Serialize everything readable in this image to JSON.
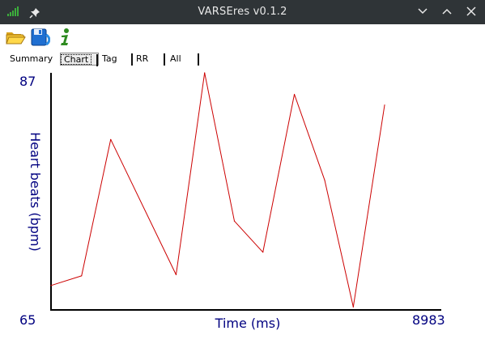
{
  "window": {
    "title": "VARSEres v0.1.2"
  },
  "titlebar": {
    "left_icons": [
      "signal-icon",
      "pin-icon"
    ],
    "right_icons": [
      "minimize-chevron-icon",
      "maximize-chevron-icon",
      "close-icon"
    ]
  },
  "toolbar": {
    "items": [
      {
        "name": "open-folder-button",
        "icon": "folder-open-icon"
      },
      {
        "name": "save-disk-button",
        "icon": "disk-icon"
      },
      {
        "name": "info-button",
        "icon": "info-icon"
      }
    ]
  },
  "tabs": [
    {
      "label": "Summary",
      "active": false
    },
    {
      "label": "Chart",
      "active": true
    },
    {
      "label": "Tag",
      "active": false
    },
    {
      "label": "RR",
      "active": false
    },
    {
      "label": "All",
      "active": false
    }
  ],
  "chart_data": {
    "type": "line",
    "title": "",
    "xlabel": "Time (ms)",
    "ylabel": "Heart beats (bpm)",
    "xlim": [
      0,
      8983
    ],
    "ylim": [
      65,
      87
    ],
    "x_tick_labels": [
      "8983"
    ],
    "y_tick_labels": [
      "87",
      "65"
    ],
    "grid": false,
    "line_color": "#cc0000",
    "axis_text_color": "#000080",
    "series": [
      {
        "x": [
          0,
          823,
          1608,
          3368,
          4136,
          4938,
          5706,
          6553,
          7370,
          8140,
          8983
        ],
        "values": [
          67.2,
          68.1,
          80.8,
          68.2,
          87.0,
          73.2,
          70.3,
          85.0,
          77.0,
          65.2,
          84.0
        ]
      }
    ]
  }
}
